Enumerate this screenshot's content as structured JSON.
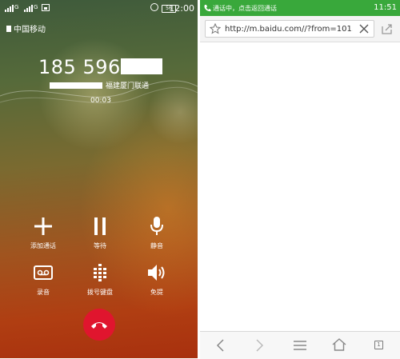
{
  "call_screen": {
    "status_bar": {
      "signal1_label": "G",
      "signal2_label": "G",
      "battery_level": "56",
      "time": "12:00"
    },
    "carrier": "中国移动",
    "phone_number_visible": "185 5969",
    "location": "福建厦门联通",
    "duration": "00:03",
    "controls": [
      {
        "label": "添加通话",
        "icon": "plus-icon"
      },
      {
        "label": "等待",
        "icon": "pause-icon"
      },
      {
        "label": "静音",
        "icon": "microphone-icon"
      },
      {
        "label": "录音",
        "icon": "voicemail-icon"
      },
      {
        "label": "拨号键盘",
        "icon": "dialpad-icon"
      },
      {
        "label": "免提",
        "icon": "speaker-icon"
      }
    ],
    "hangup_icon": "phone-hangup-icon",
    "colors": {
      "hangup": "#e0152e"
    }
  },
  "browser": {
    "call_bar": {
      "text": "通话中，点击返回通话",
      "time": "11:51",
      "color": "#39a83b"
    },
    "url": "http://m.baidu.com//?from=101...",
    "bottom_nav": {
      "icons": [
        "back-icon",
        "forward-icon",
        "menu-icon",
        "home-icon",
        "tabs-icon"
      ],
      "tab_count": "1"
    }
  }
}
